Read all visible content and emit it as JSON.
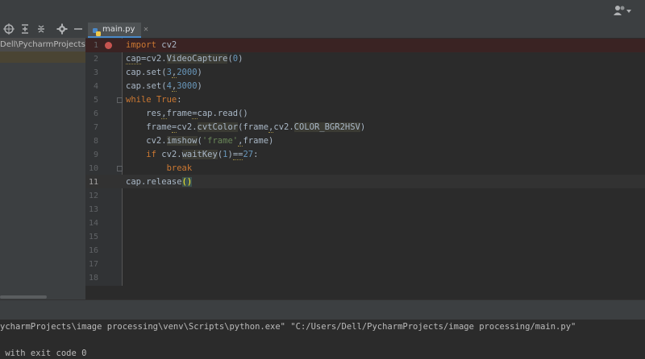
{
  "tabs": [
    {
      "label": "main.py",
      "active": true
    }
  ],
  "project": {
    "path_text": "Dell\\PycharmProjects\\image"
  },
  "toolbar": {
    "icons": [
      "target-icon",
      "expand-all-icon",
      "collapse-all-icon",
      "gear-icon",
      "minimize-icon"
    ]
  },
  "editor": {
    "line_numbers": [
      "1",
      "2",
      "3",
      "4",
      "5",
      "6",
      "7",
      "8",
      "9",
      "10",
      "11",
      "12",
      "13",
      "14",
      "15",
      "16",
      "17",
      "18"
    ],
    "current_line": "11",
    "breakpoint_line": "1"
  },
  "run": {
    "command_line": "ycharmProjects\\image processing\\venv\\Scripts\\python.exe\" \"C:/Users/Dell/PycharmProjects/image processing/main.py\"",
    "exit_line": " with exit code 0"
  },
  "colors": {
    "keyword": "#cc7832",
    "number": "#6897bb",
    "string": "#6a8759",
    "text": "#a9b7c6",
    "breakpoint": "#c75450"
  }
}
